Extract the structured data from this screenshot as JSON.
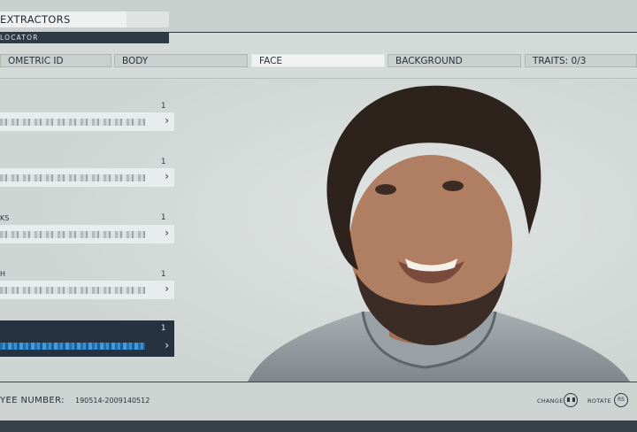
{
  "header": {
    "title": "EXTRACTORS",
    "subtitle": "LOCATOR"
  },
  "tabs": [
    {
      "label": "OMETRIC ID",
      "active": false
    },
    {
      "label": "BODY",
      "active": false
    },
    {
      "label": "FACE",
      "active": true
    },
    {
      "label": "BACKGROUND",
      "active": false
    },
    {
      "label": "TRAITS: 0/3",
      "active": false
    }
  ],
  "sliders": [
    {
      "label": "",
      "count": "1",
      "active": false
    },
    {
      "label": "",
      "count": "1",
      "active": false
    },
    {
      "label": "KS",
      "count": "1",
      "active": false
    },
    {
      "label": "H",
      "count": "1",
      "active": false
    },
    {
      "label": "",
      "count": "1",
      "active": true
    }
  ],
  "footer": {
    "employee_label": "YEE NUMBER:",
    "employee_number": "190514-2009140512",
    "change_label": "CHANGE",
    "rotate_label": "ROTATE",
    "rotate_button": "RS"
  },
  "colors": {
    "accent_dark": "#263240",
    "slider_active": "#2e86c8",
    "background": "#d4dad8"
  },
  "icons": {
    "slider_arrow": "chevron-right-icon",
    "change": "controller-button-icon",
    "rotate": "rs-button-icon"
  }
}
